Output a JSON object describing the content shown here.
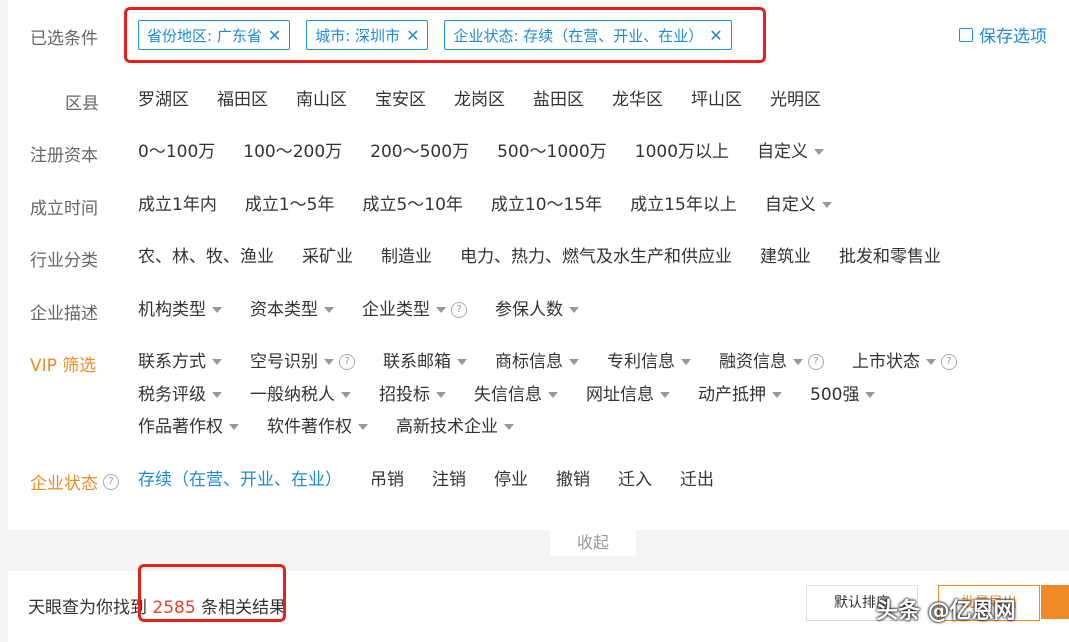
{
  "selected": {
    "label": "已选条件",
    "chips": [
      {
        "text": "省份地区: 广东省"
      },
      {
        "text": "城市: 深圳市"
      },
      {
        "text": "企业状态: 存续（在营、开业、在业）"
      }
    ],
    "close_glyph": "✕",
    "save_label": "保存选项"
  },
  "filters": {
    "district": {
      "label": "区县",
      "items": [
        "罗湖区",
        "福田区",
        "南山区",
        "宝安区",
        "龙岗区",
        "盐田区",
        "龙华区",
        "坪山区",
        "光明区"
      ]
    },
    "capital": {
      "label": "注册资本",
      "items": [
        "0～100万",
        "100～200万",
        "200～500万",
        "500～1000万",
        "1000万以上"
      ],
      "custom": "自定义"
    },
    "founded": {
      "label": "成立时间",
      "items": [
        "成立1年内",
        "成立1～5年",
        "成立5～10年",
        "成立10～15年",
        "成立15年以上"
      ],
      "custom": "自定义"
    },
    "industry": {
      "label": "行业分类",
      "items": [
        "农、林、牧、渔业",
        "采矿业",
        "制造业",
        "电力、热力、燃气及水生产和供应业",
        "建筑业",
        "批发和零售业"
      ]
    },
    "desc": {
      "label": "企业描述",
      "items": [
        {
          "text": "机构类型",
          "q": false
        },
        {
          "text": "资本类型",
          "q": false
        },
        {
          "text": "企业类型",
          "q": true
        },
        {
          "text": "参保人数",
          "q": false
        }
      ]
    },
    "vip": {
      "label": "VIP 筛选",
      "lines": [
        [
          {
            "text": "联系方式",
            "q": false
          },
          {
            "text": "空号识别",
            "q": true
          },
          {
            "text": "联系邮箱",
            "q": false
          },
          {
            "text": "商标信息",
            "q": false
          },
          {
            "text": "专利信息",
            "q": false
          },
          {
            "text": "融资信息",
            "q": true
          },
          {
            "text": "上市状态",
            "q": true
          }
        ],
        [
          {
            "text": "税务评级",
            "q": false
          },
          {
            "text": "一般纳税人",
            "q": false
          },
          {
            "text": "招投标",
            "q": false
          },
          {
            "text": "失信信息",
            "q": false
          },
          {
            "text": "网址信息",
            "q": false
          },
          {
            "text": "动产抵押",
            "q": false
          },
          {
            "text": "500强",
            "q": false
          }
        ],
        [
          {
            "text": "作品著作权",
            "q": false
          },
          {
            "text": "软件著作权",
            "q": false
          },
          {
            "text": "高新技术企业",
            "q": false
          }
        ]
      ]
    },
    "status": {
      "label": "企业状态",
      "active": "存续（在营、开业、在业）",
      "items": [
        "吊销",
        "注销",
        "停业",
        "撤销",
        "迁入",
        "迁出"
      ]
    }
  },
  "collapse_label": "收起",
  "results": {
    "prefix": "天眼查为你找到 ",
    "count": "2585",
    "suffix": " 条相关结果",
    "sort_label": "默认排序",
    "export_label": "批量导出"
  },
  "watermark": "头条 @亿恩网",
  "colors": {
    "accent": "#1f8ad6",
    "vip": "#f08a24",
    "highlight": "#e8201d",
    "count": "#e8412c"
  }
}
